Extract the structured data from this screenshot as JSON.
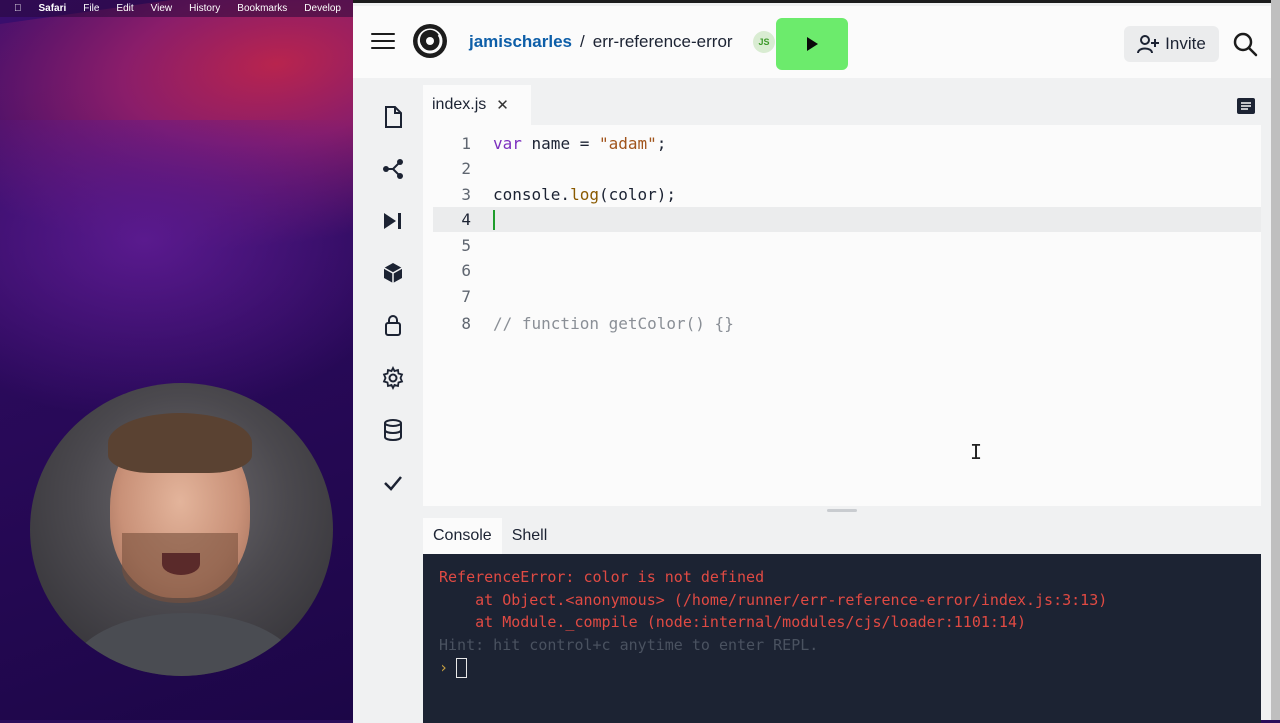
{
  "menubar": {
    "app_name": "Safari",
    "items": [
      "File",
      "Edit",
      "View",
      "History",
      "Bookmarks",
      "Develop"
    ]
  },
  "header": {
    "user": "jamischarles",
    "separator": "/",
    "repl_name": "err-reference-error",
    "lang_badge": "JS",
    "invite_label": "Invite"
  },
  "editor": {
    "tab_name": "index.js",
    "active_line": 4,
    "lines": [
      {
        "num": "1"
      },
      {
        "num": "2"
      },
      {
        "num": "3"
      },
      {
        "num": "4"
      },
      {
        "num": "5"
      },
      {
        "num": "6"
      },
      {
        "num": "7"
      },
      {
        "num": "8"
      }
    ],
    "code": {
      "l1_kw": "var",
      "l1_rest": " name = ",
      "l1_str": "\"adam\"",
      "l1_end": ";",
      "l3_obj": "console.",
      "l3_fn": "log",
      "l3_rest": "(color);",
      "l8_comment": "// function getColor() {}"
    }
  },
  "console_tabs": {
    "console": "Console",
    "shell": "Shell"
  },
  "console": {
    "error": "ReferenceError: color is not defined",
    "trace1": "    at Object.<anonymous> (/home/runner/err-reference-error/index.js:3:13)",
    "trace2": "    at Module._compile (node:internal/modules/cjs/loader:1101:14)",
    "hint": "Hint: hit control+c anytime to enter REPL.",
    "prompt": "›"
  },
  "colors": {
    "run_button": "#6ceb6c",
    "console_bg": "#1c2333",
    "error_text": "#e04a43",
    "link_user": "#0d5ea8"
  }
}
